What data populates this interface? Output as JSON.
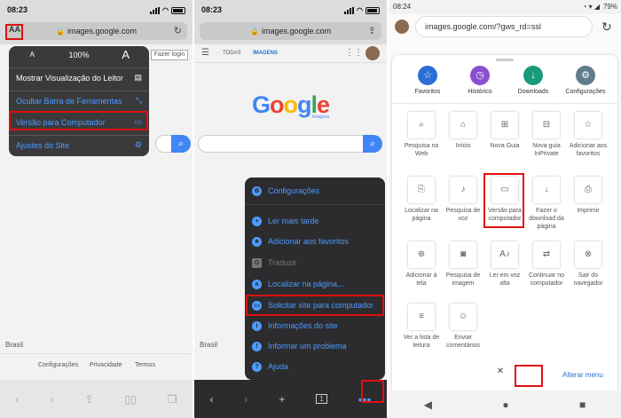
{
  "panel1": {
    "time": "08:23",
    "url": "images.google.com",
    "aa_label": "AA",
    "font_small": "A",
    "zoom": "100%",
    "font_large": "A",
    "reader": "Mostrar Visualização do Leitor",
    "hide_toolbar": "Ocultar Barra de Ferramentas",
    "desktop": "Versão para Computador",
    "site_settings": "Ajustes do Site",
    "login": "Fazer login",
    "country": "Brasil",
    "footer": [
      "Configurações",
      "Privacidade",
      "Termos"
    ]
  },
  "panel2": {
    "time": "08:23",
    "url": "images.google.com",
    "tab_all": "TODAS",
    "tab_images": "IMAGENS",
    "logo_sub": "Imagens",
    "menu": {
      "settings": "Configurações",
      "read_later": "Ler mais tarde",
      "add_favorites": "Adicionar aos favoritos",
      "translate": "Traduzir",
      "find": "Localizar na página...",
      "request_desktop": "Solicitar site para computador",
      "site_info": "Informações do site",
      "report": "Informar um problema",
      "help": "Ajuda"
    },
    "country": "Brasil",
    "tab_count": "1"
  },
  "panel3": {
    "time": "08:24",
    "battery": "79%",
    "url": "images.google.com/?gws_rd=ssl",
    "top": [
      "Favoritos",
      "Histórico",
      "Downloads",
      "Configurações"
    ],
    "colors": {
      "fav": "#2b6fd6",
      "hist": "#8a4fd0",
      "down": "#1a9a7a",
      "conf": "#607d8b",
      "red": "#e01010"
    },
    "tiles": [
      "Pesquisa na Web",
      "Início",
      "Nova Guia",
      "Nova guia InPrivate",
      "Adicionar aos favoritos",
      "Localizar na página",
      "Pesquisa de voz",
      "Versão para computador",
      "Fazer o download da página",
      "Imprimir",
      "Adicionar à tela",
      "Pesquisa de imagem",
      "Ler em voz alta",
      "Continuar no computador",
      "Sair do navegador",
      "Ver a lista de leitura",
      "Enviar comentários"
    ],
    "change_menu": "Alterar menu"
  }
}
